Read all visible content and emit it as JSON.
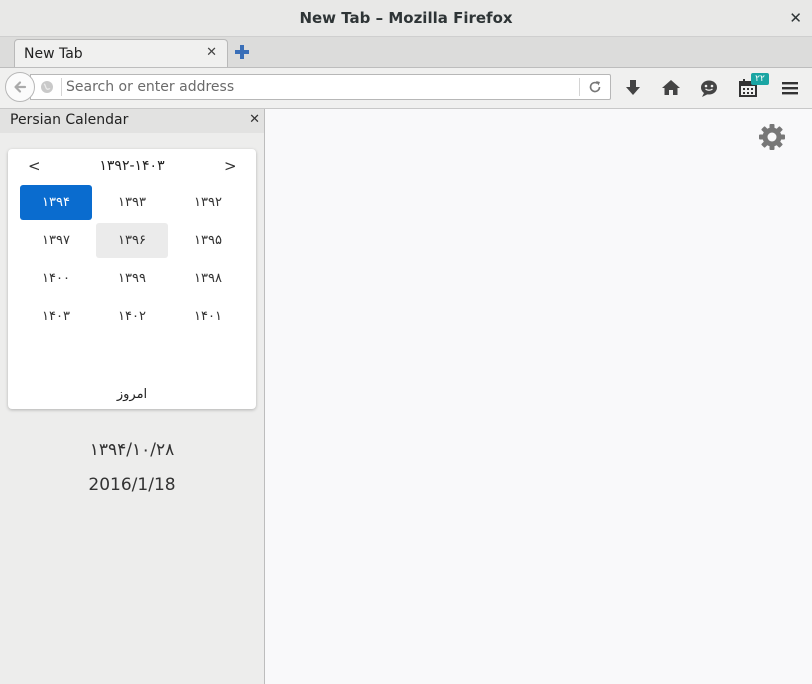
{
  "window": {
    "title": "New Tab – Mozilla Firefox"
  },
  "tabs": [
    {
      "label": "New Tab"
    }
  ],
  "navbar": {
    "search_placeholder": "Search or enter address",
    "calendar_badge": "۲۲"
  },
  "sidebar": {
    "title": "Persian Calendar",
    "calendar": {
      "range_label": "۱۳۹۲-۱۴۰۳",
      "prev_label": "<",
      "next_label": ">",
      "years": [
        [
          "۱۳۹۴",
          "۱۳۹۳",
          "۱۳۹۲"
        ],
        [
          "۱۳۹۷",
          "۱۳۹۶",
          "۱۳۹۵"
        ],
        [
          "۱۴۰۰",
          "۱۳۹۹",
          "۱۳۹۸"
        ],
        [
          "۱۴۰۳",
          "۱۴۰۲",
          "۱۴۰۱"
        ]
      ],
      "selected_year": "۱۳۹۴",
      "hovered_year": "۱۳۹۶",
      "today_label": "امروز"
    },
    "persian_date": "۱۳۹۴/۱۰/۲۸",
    "gregorian_date": "2016/1/18"
  },
  "colors": {
    "selected": "#0a6ccf",
    "badge": "#1aa5a3"
  }
}
